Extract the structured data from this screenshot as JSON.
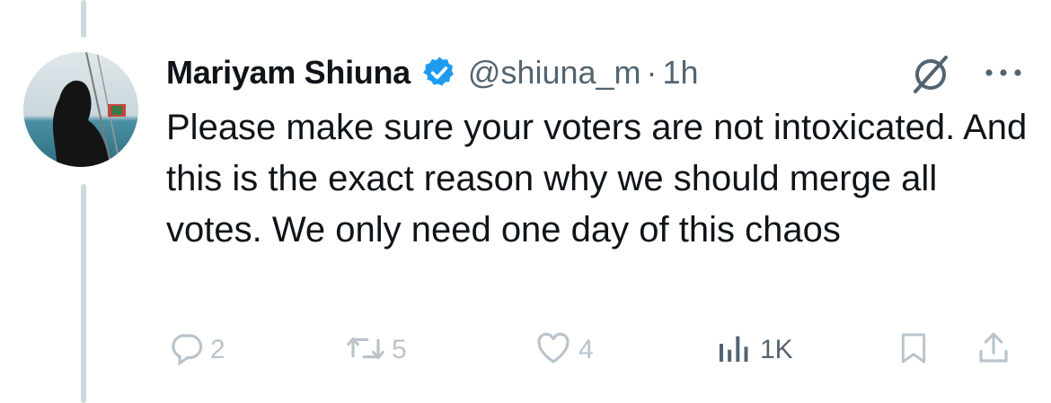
{
  "tweet": {
    "author": {
      "name": "Mariyam Shiuna",
      "handle": "@shiuna_m",
      "verified": true
    },
    "separator": "·",
    "time": "1h",
    "text": "Please make sure your voters are not intoxicated. And this is the exact reason why we should merge all votes. We only need one day of this chaos"
  },
  "actions": {
    "reply_count": "2",
    "retweet_count": "5",
    "like_count": "4",
    "views_count": "1K"
  },
  "icons": {
    "grok": "grok-icon",
    "more": "more-icon",
    "reply": "reply-icon",
    "retweet": "retweet-icon",
    "like": "heart-icon",
    "views": "analytics-icon",
    "bookmark": "bookmark-icon",
    "share": "share-icon"
  },
  "colors": {
    "verified": "#1d9bf0",
    "secondary_text": "#536471",
    "faded_action": "#b9c4cc",
    "thread_line": "#cfd9de"
  }
}
